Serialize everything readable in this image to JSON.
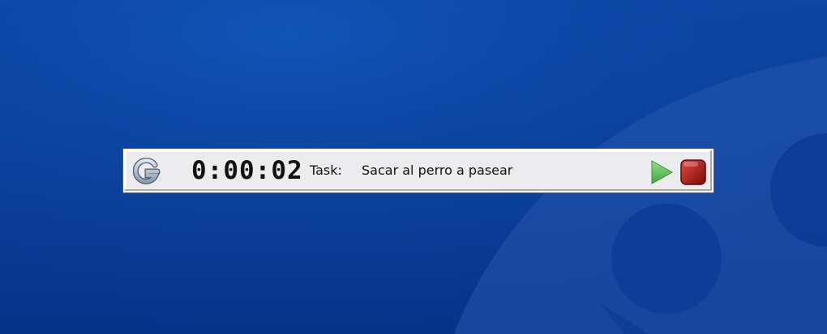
{
  "timer": {
    "elapsed": "0:00:02",
    "task_label": "Task:",
    "task_value": "Sacar al perro a pasear"
  },
  "icons": {
    "logo": "g-logo-icon",
    "play": "play-icon",
    "stop": "stop-icon"
  },
  "colors": {
    "desktop_blue": "#0a3f9c",
    "bar_background": "#ecebee",
    "play_green": "#5ec35a",
    "stop_red": "#b30f0f"
  }
}
